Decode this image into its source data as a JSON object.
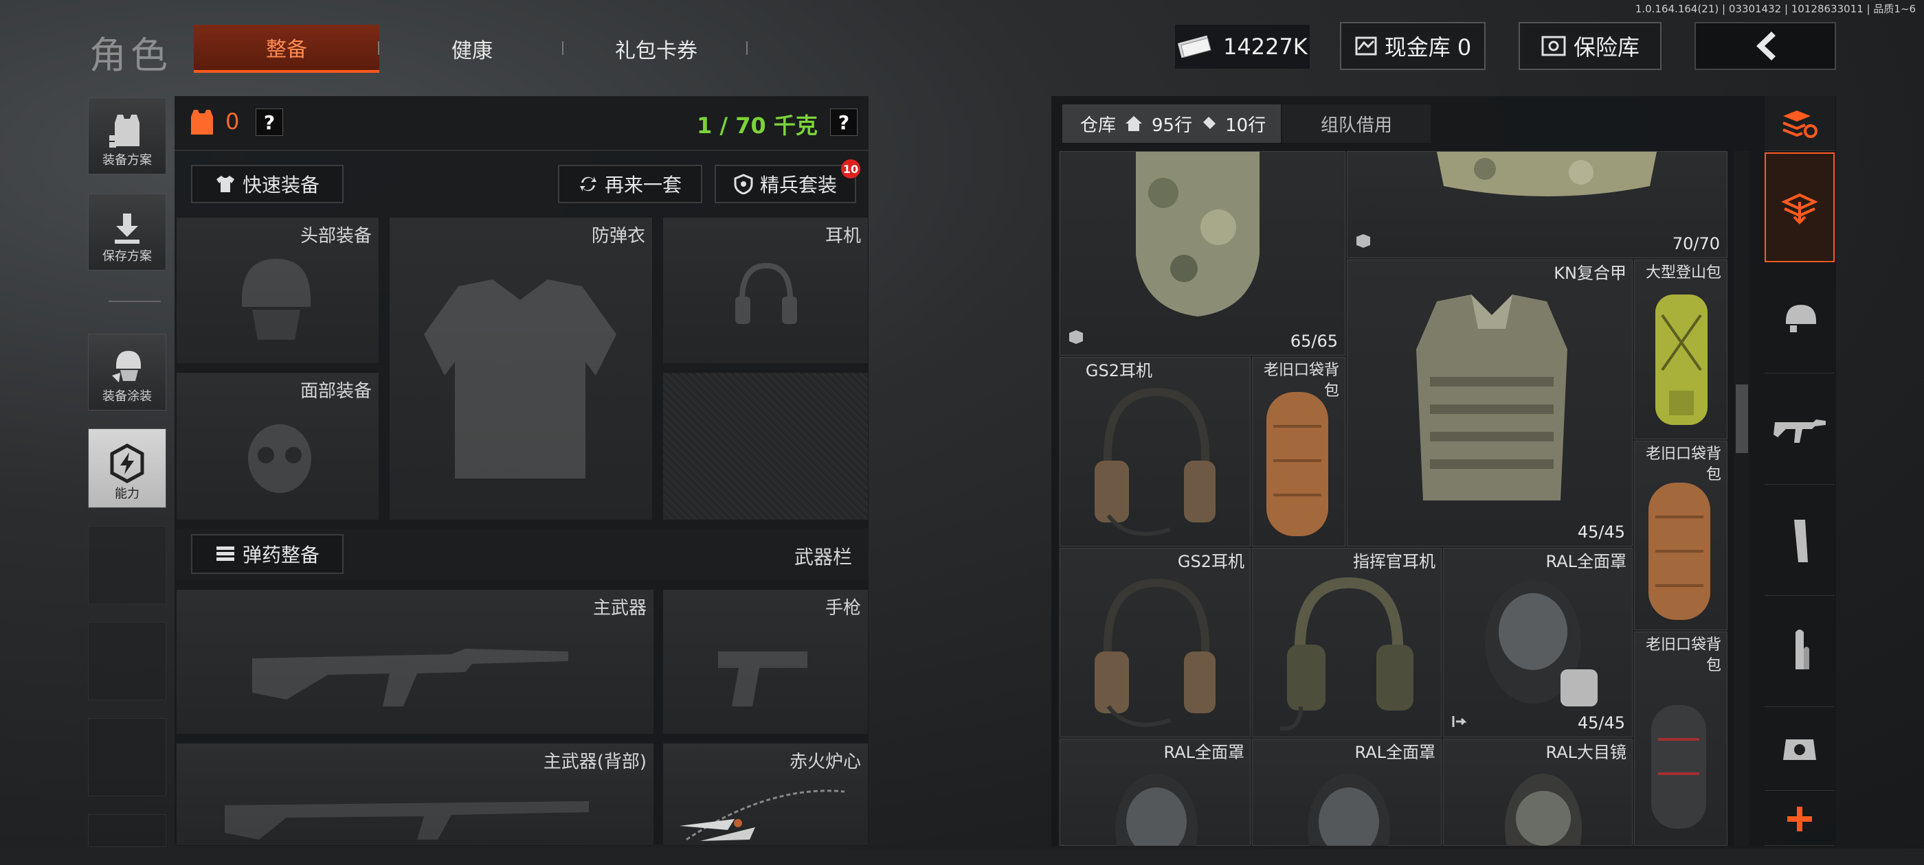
{
  "version": "1.0.164.164(21) | 03301432 | 10128633011 | 品质1~6",
  "header": {
    "title": "角色",
    "tabs": [
      {
        "label": "整备",
        "active": true
      },
      {
        "label": "健康",
        "active": false
      },
      {
        "label": "礼包卡券",
        "active": false
      }
    ],
    "money": "14227K",
    "cash_vault_label": "现金库 0",
    "insurance_label": "保险库"
  },
  "sidebar": {
    "items": [
      {
        "label": "装备方案",
        "icon": "vest-plan-icon"
      },
      {
        "label": "保存方案",
        "icon": "download-icon"
      },
      {
        "label": "装备涂装",
        "icon": "paint-helmet-icon"
      },
      {
        "label": "能力",
        "icon": "lightning-hex-icon"
      }
    ]
  },
  "loadout": {
    "armor_count": "0",
    "weight": "1 / 70 千克",
    "quick_equip": "快速装备",
    "again_set": "再来一套",
    "elite_set": "精兵套装",
    "elite_badge": "10",
    "slots": {
      "head": "头部装备",
      "armor": "防弹衣",
      "headset": "耳机",
      "face": "面部装备"
    },
    "ammo_button": "弹药整备",
    "weapon_bar": "武器栏",
    "weapons": {
      "primary": "主武器",
      "pistol": "手枪",
      "primary_back": "主武器(背部)",
      "melee": "赤火炉心"
    }
  },
  "warehouse": {
    "tab_label": "仓库",
    "rows_house": "95行",
    "rows_ticket": "10行",
    "team_loan": "组队借用",
    "items": [
      {
        "name": "",
        "count": "65/65"
      },
      {
        "name": "",
        "count": "70/70"
      },
      {
        "name": "KN复合甲",
        "count": "45/45"
      },
      {
        "name": "大型登山包",
        "count": ""
      },
      {
        "name": "GS2耳机",
        "count": ""
      },
      {
        "name": "老旧口袋背包",
        "count": ""
      },
      {
        "name": "老旧口袋背包",
        "count": ""
      },
      {
        "name": "GS2耳机",
        "count": ""
      },
      {
        "name": "指挥官耳机",
        "count": ""
      },
      {
        "name": "RAL全面罩",
        "count": "45/45"
      },
      {
        "name": "老旧口袋背包",
        "count": ""
      },
      {
        "name": "RAL全面罩",
        "count": ""
      },
      {
        "name": "RAL全面罩",
        "count": ""
      },
      {
        "name": "RAL大目镜",
        "count": ""
      }
    ]
  },
  "colors": {
    "accent": "#ff5a1f",
    "weight_green": "#7cd33a",
    "badge_red": "#e02020"
  }
}
